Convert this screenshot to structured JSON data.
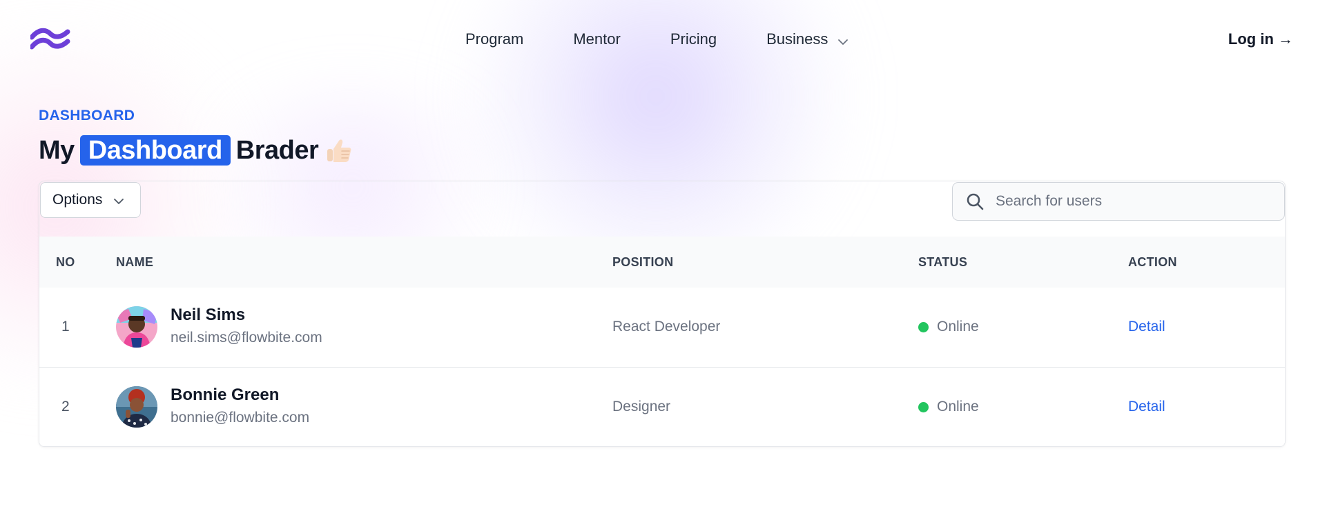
{
  "nav": {
    "items": [
      {
        "label": "Program"
      },
      {
        "label": "Mentor"
      },
      {
        "label": "Pricing"
      },
      {
        "label": "Business"
      }
    ],
    "login_label": "Log in →"
  },
  "hero": {
    "eyebrow": "DASHBOARD",
    "title_prefix": "My",
    "title_highlight": "Dashboard",
    "title_suffix": "Brader"
  },
  "toolbar": {
    "options_label": "Options",
    "search_placeholder": "Search for users"
  },
  "table": {
    "headers": {
      "no": "NO",
      "name": "NAME",
      "position": "POSITION",
      "status": "STATUS",
      "action": "ACTION"
    },
    "rows": [
      {
        "no": "1",
        "name": "Neil Sims",
        "email": "neil.sims@flowbite.com",
        "position": "React Developer",
        "status": "Online",
        "action": "Detail"
      },
      {
        "no": "2",
        "name": "Bonnie Green",
        "email": "bonnie@flowbite.com",
        "position": "Designer",
        "status": "Online",
        "action": "Detail"
      }
    ]
  },
  "colors": {
    "accent": "#2563eb",
    "online": "#22c55e",
    "logo": "#6d3fd8"
  },
  "icons": {
    "logo": "wave-logo-icon",
    "dropdown": "chevron-down-icon",
    "search": "search-icon",
    "emoji": "thumbs-up-emoji-icon"
  }
}
